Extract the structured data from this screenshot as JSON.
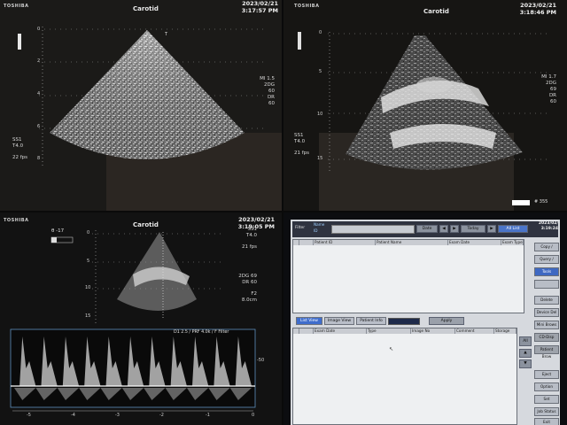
{
  "brand": "TOSHIBA",
  "panels": [
    {
      "brand": "TOSHIBA",
      "title": "Carotid",
      "date": "2023/02/21",
      "time": "3:17:57 PM",
      "params_right": [
        "MI 1.5",
        "2DG",
        "60",
        "DR",
        "60"
      ],
      "params_left": [
        "SS1",
        "T4.0",
        "22 fps"
      ],
      "depth_ticks": [
        "0",
        "2",
        "4",
        "6",
        "8"
      ]
    },
    {
      "brand": "TOSHIBA",
      "title": "Carotid",
      "date": "2023/02/21",
      "time": "3:18:46 PM",
      "params_right": [
        "MI 1.7",
        "2DG",
        "69",
        "DR",
        "60"
      ],
      "params_left": [
        "SS1",
        "T4.0",
        "21 fps"
      ],
      "depth_ticks": [
        "0",
        "5",
        "10",
        "15"
      ],
      "scale_label": "# 355"
    },
    {
      "brand": "TOSHIBA",
      "title": "Carotid",
      "date": "2023/02/21",
      "time": "3:19:05 PM",
      "params_right": [
        "SS1",
        "T4.0",
        "21 fps",
        "2DG 69",
        "DR 60",
        "F2",
        "8.0cm"
      ],
      "doppler_label": "D1 2.5 / PRF 4.0k / F Filter",
      "depth_ticks": [
        "0",
        "5",
        "10",
        "15"
      ],
      "velocity_ticks": [
        "-50"
      ],
      "time_ticks": [
        "-5",
        "-4",
        "-3",
        "-2",
        "-1",
        "0"
      ],
      "angle_label": "θ -17"
    },
    {
      "window": {
        "filter_label": "Filter",
        "name_label": "Name",
        "id_label": "ID",
        "date_btn": "Date",
        "today_btn": "Today",
        "all_list_btn": "All List",
        "patient_columns": [
          "",
          "",
          "Patient ID",
          "Patient Name",
          "Exam Date",
          "Exam Type"
        ],
        "tabs": [
          "List View",
          "Image View",
          "Patient Info"
        ],
        "apply_btn": "Apply",
        "image_columns": [
          "",
          "",
          "Exam Date",
          "Type",
          "Image No",
          "Comment",
          "Storage"
        ],
        "all_label": "All",
        "side_buttons_top": [
          "Copy /",
          "Query /",
          "Tools",
          "",
          "Delete",
          "Device Del",
          "Mini Brows",
          "CD-Disp",
          "Patient Brow"
        ],
        "side_buttons_bottom": [
          "Eject",
          "Option",
          "Set",
          "Job Status",
          "Exit"
        ],
        "clock_date": "2023/02/",
        "clock_time": "3:19:24"
      }
    }
  ]
}
